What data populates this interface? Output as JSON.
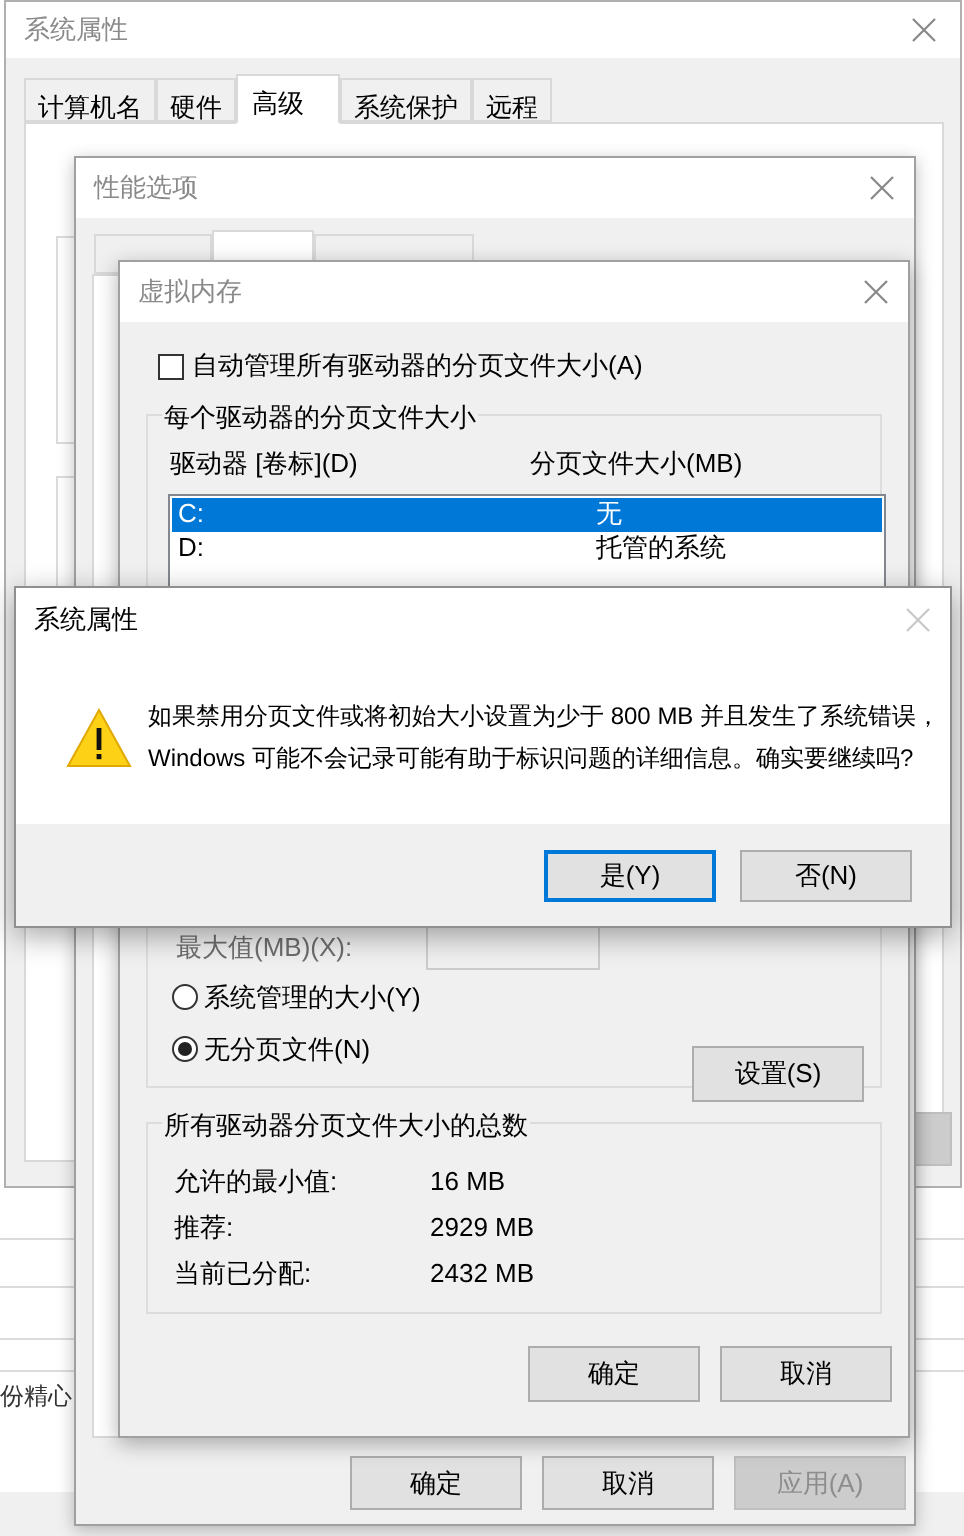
{
  "background_page": {
    "text": "份精心"
  },
  "system_properties": {
    "title": "系统属性",
    "tabs": [
      {
        "label": "计算机名",
        "selected": false
      },
      {
        "label": "硬件",
        "selected": false
      },
      {
        "label": "高级",
        "selected": true
      },
      {
        "label": "系统保护",
        "selected": false
      },
      {
        "label": "远程",
        "selected": false
      }
    ]
  },
  "performance_options": {
    "title": "性能选项",
    "tabs": [
      {
        "selected": false
      },
      {
        "selected": true
      },
      {
        "selected": false
      }
    ],
    "buttons": [
      {
        "label": "确定",
        "disabled": false
      },
      {
        "label": "取消",
        "disabled": false
      },
      {
        "label": "应用(A)",
        "disabled": true
      }
    ]
  },
  "virtual_memory": {
    "title": "虚拟内存",
    "auto_manage": {
      "label": "自动管理所有驱动器的分页文件大小(A)",
      "checked": false
    },
    "per_drive": {
      "title": "每个驱动器的分页文件大小",
      "columns": [
        "驱动器 [卷标](D)",
        "分页文件大小(MB)"
      ],
      "rows": [
        {
          "drive": "C:",
          "size": "无",
          "selected": true
        },
        {
          "drive": "D:",
          "size": "托管的系统",
          "selected": false
        }
      ],
      "maximum": {
        "label": "最大值(MB)(X):",
        "disabled": true
      },
      "options": [
        {
          "label": "系统管理的大小(Y)",
          "selected": false
        },
        {
          "label": "无分页文件(N)",
          "selected": true
        }
      ],
      "set_button": "设置(S)"
    },
    "totals": {
      "title": "所有驱动器分页文件大小的总数",
      "rows": [
        {
          "label": "允许的最小值:",
          "value": "16 MB"
        },
        {
          "label": "推荐:",
          "value": "2929 MB"
        },
        {
          "label": "当前已分配:",
          "value": "2432 MB"
        }
      ]
    },
    "buttons": [
      "确定",
      "取消"
    ]
  },
  "alert": {
    "title": "系统属性",
    "message": [
      "如果禁用分页文件或将初始大小设置为少于 800 MB 并且发生了系统错误，",
      "Windows 可能不会记录可能有助于标识问题的详细信息。确实要继续吗?"
    ],
    "buttons": [
      {
        "label": "是(Y)",
        "default": true
      },
      {
        "label": "否(N)",
        "default": false
      }
    ]
  }
}
